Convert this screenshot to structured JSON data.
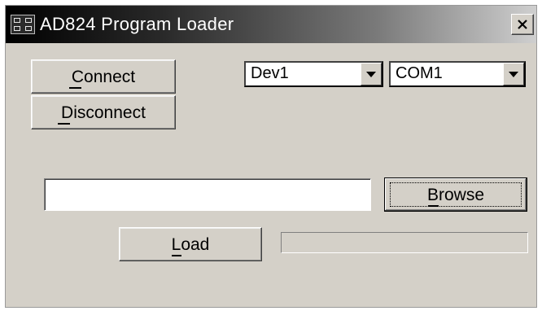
{
  "window": {
    "title": "AD824 Program Loader",
    "close_icon": "close-icon",
    "app_icon": "ad-app-icon"
  },
  "buttons": {
    "connect": {
      "label": "Connect",
      "mnemonic": "C"
    },
    "disconnect": {
      "label": "Disconnect",
      "mnemonic": "D"
    },
    "browse": {
      "label": "Browse",
      "mnemonic": "B"
    },
    "load": {
      "label": "Load",
      "mnemonic": "L"
    }
  },
  "device_select": {
    "value": "Dev1"
  },
  "port_select": {
    "value": "COM1"
  },
  "file_path": {
    "value": ""
  },
  "progress": {
    "value": 0
  },
  "colors": {
    "face": "#d4d0c8",
    "title_start": "#000000",
    "title_end": "#cfcfcf"
  }
}
